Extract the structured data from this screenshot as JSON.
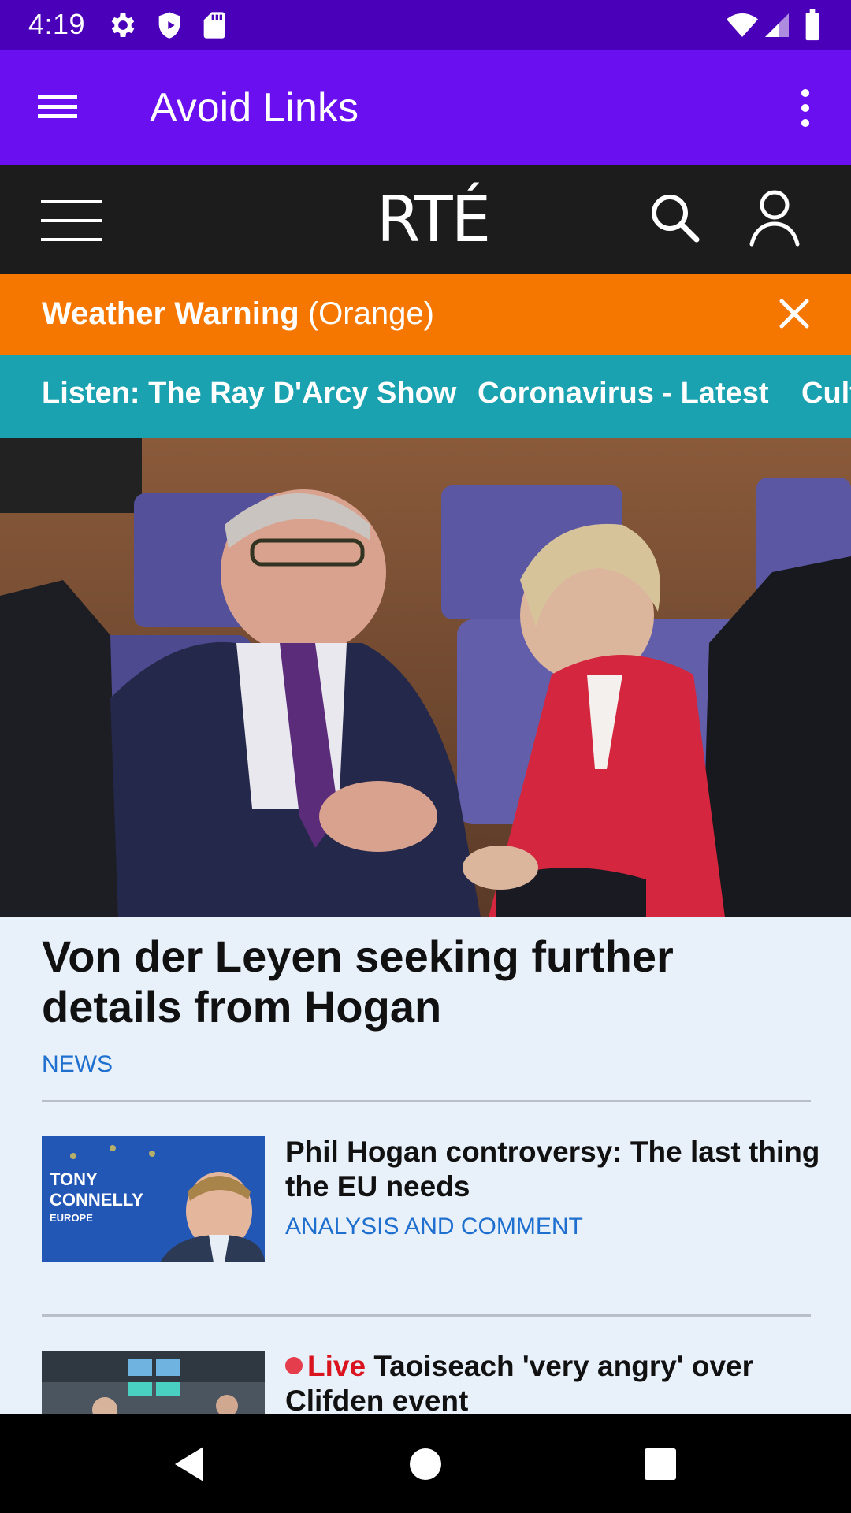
{
  "status_bar": {
    "time": "4:19",
    "icons": [
      "settings-icon",
      "shield-icon",
      "sd-card-icon",
      "wifi-icon",
      "signal-icon",
      "battery-icon"
    ]
  },
  "app_bar": {
    "title": "Avoid Links",
    "menu_icon": "hamburger-menu-icon",
    "overflow_icon": "more-vert-icon",
    "color": "#6a0ff0"
  },
  "site_header": {
    "logo": "RTÉ",
    "icons": [
      "hamburger-menu-icon",
      "search-icon",
      "account-icon"
    ]
  },
  "weather_warning": {
    "bold": "Weather Warning",
    "level": "(Orange)",
    "close_icon": "close-icon",
    "color": "#f57700"
  },
  "nav_links": [
    "Listen: The Ray D'Arcy Show",
    "Coronavirus - Latest",
    "Cult"
  ],
  "hero": {
    "headline": "Von der Leyen seeking further details from Hogan",
    "tag": "NEWS"
  },
  "stories": [
    {
      "title": "Phil Hogan controversy: The last thing the EU needs",
      "tag": "ANALYSIS AND COMMENT",
      "thumb_text": {
        "line1": "TONY",
        "line2": "CONNELLY",
        "line3": "EUROPE"
      }
    },
    {
      "live_label": "Live",
      "title": "Taoiseach 'very angry' over Clifden event"
    }
  ],
  "system_nav": [
    "back-icon",
    "home-icon",
    "recents-icon"
  ]
}
